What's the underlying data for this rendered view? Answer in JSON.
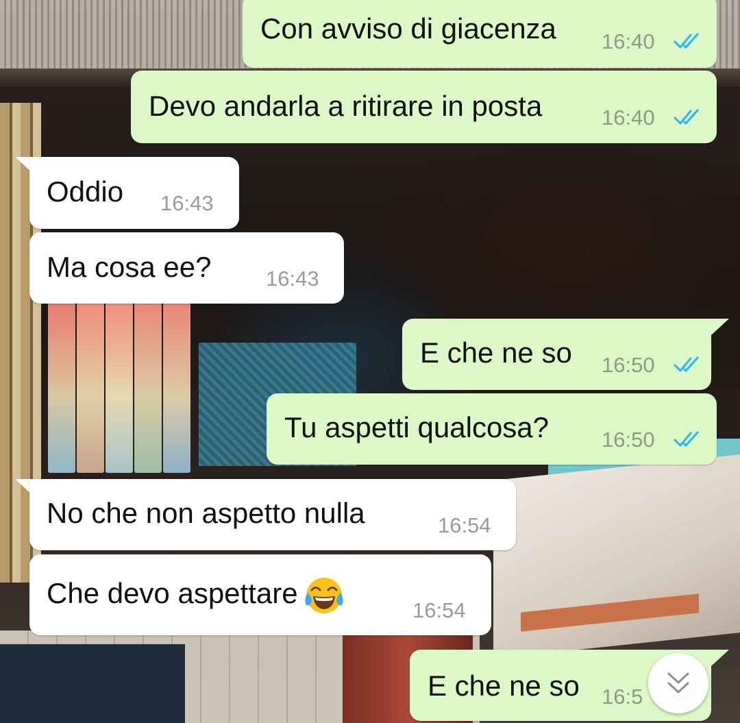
{
  "messages": [
    {
      "direction": "outgoing",
      "text": "Con avviso di giacenza",
      "time": "16:40",
      "status": "read"
    },
    {
      "direction": "outgoing",
      "text": "Devo andarla a ritirare in posta",
      "time": "16:40",
      "status": "read"
    },
    {
      "direction": "incoming",
      "text": "Oddio",
      "time": "16:43"
    },
    {
      "direction": "incoming",
      "text": "Ma cosa ee?",
      "time": "16:43"
    },
    {
      "direction": "outgoing",
      "text": "E che ne so",
      "time": "16:50",
      "status": "read"
    },
    {
      "direction": "outgoing",
      "text": "Tu aspetti qualcosa?",
      "time": "16:50",
      "status": "read"
    },
    {
      "direction": "incoming",
      "text": "No che non aspetto nulla",
      "time": "16:54"
    },
    {
      "direction": "incoming",
      "text": "Che devo aspettare",
      "time": "16:54",
      "emoji": "face-with-tears-of-joy"
    },
    {
      "direction": "outgoing",
      "text": "E che ne so",
      "time": "16:5",
      "status": "read"
    }
  ],
  "colors": {
    "outgoing_bubble": "#dcf8c6",
    "incoming_bubble": "#ffffff",
    "read_ticks": "#34b7f1",
    "timestamp": "#8d9a88"
  },
  "icons": {
    "read_receipt": "double-check-icon",
    "scroll_down": "double-chevron-down-icon",
    "emoji": "face-with-tears-of-joy-icon"
  }
}
